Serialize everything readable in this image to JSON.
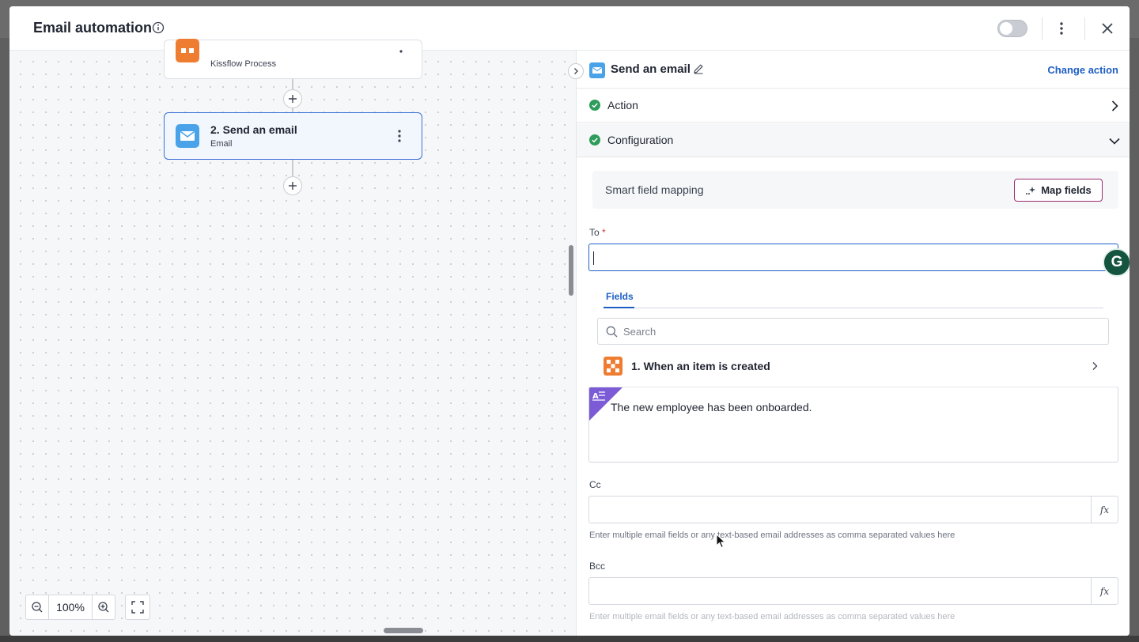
{
  "modal": {
    "title": "Email automation"
  },
  "canvas": {
    "node_top": {
      "subtitle": "Kissflow Process"
    },
    "node_active": {
      "title": "2. Send an email",
      "subtitle": "Email"
    },
    "zoom_level": "100%"
  },
  "panel": {
    "title": "Send an email",
    "change_action": "Change action",
    "sections": {
      "action": "Action",
      "configuration": "Configuration"
    },
    "smart_mapping": {
      "label": "Smart field mapping",
      "button": "Map fields"
    },
    "to": {
      "label": "To",
      "required_mark": "*",
      "value": ""
    },
    "dropdown": {
      "tab": "Fields",
      "search_placeholder": "Search",
      "items": [
        {
          "label": "1. When an item is created"
        }
      ]
    },
    "body": {
      "text": "The new employee has been onboarded."
    },
    "cc": {
      "label": "Cc",
      "fx": "fx",
      "hint": "Enter multiple email fields or any text-based email addresses as comma separated values here"
    },
    "bcc": {
      "label": "Bcc",
      "fx": "fx",
      "hint": "Enter multiple email fields or any text-based email addresses as comma separated values here"
    },
    "grammarly_letter": "G"
  },
  "colors": {
    "accent_blue": "#1f5fc4",
    "success_green": "#2e9c5b",
    "kissflow_orange": "#ef7d31",
    "mail_blue": "#4aa3e8",
    "map_button_border": "#9b2c6f",
    "rich_text_purple": "#7b5bd6"
  }
}
